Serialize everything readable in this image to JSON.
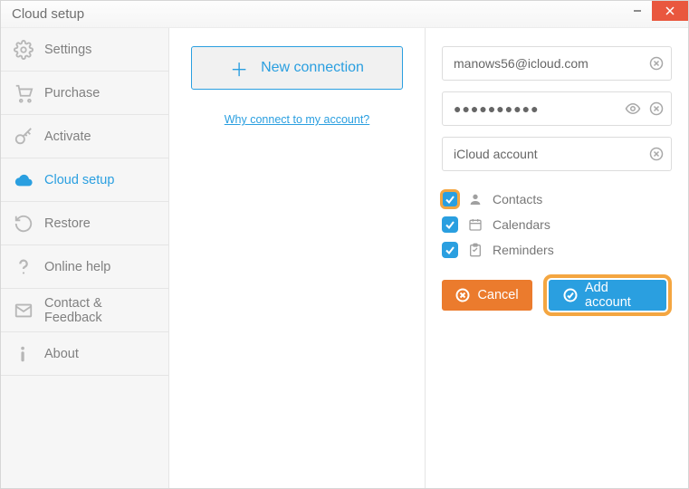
{
  "window": {
    "title": "Cloud setup"
  },
  "sidebar": {
    "items": [
      {
        "label": "Settings"
      },
      {
        "label": "Purchase"
      },
      {
        "label": "Activate"
      },
      {
        "label": "Cloud setup"
      },
      {
        "label": "Restore"
      },
      {
        "label": "Online help"
      },
      {
        "label": "Contact & Feedback"
      },
      {
        "label": "About"
      }
    ]
  },
  "mid": {
    "new_connection": "New connection",
    "why_link": "Why connect to my account?"
  },
  "form": {
    "email": "manows56@icloud.com",
    "password": "●●●●●●●●●●",
    "name": "iCloud account",
    "options": [
      {
        "label": "Contacts",
        "checked": true
      },
      {
        "label": "Calendars",
        "checked": true
      },
      {
        "label": "Reminders",
        "checked": true
      }
    ],
    "cancel": "Cancel",
    "add": "Add account"
  }
}
